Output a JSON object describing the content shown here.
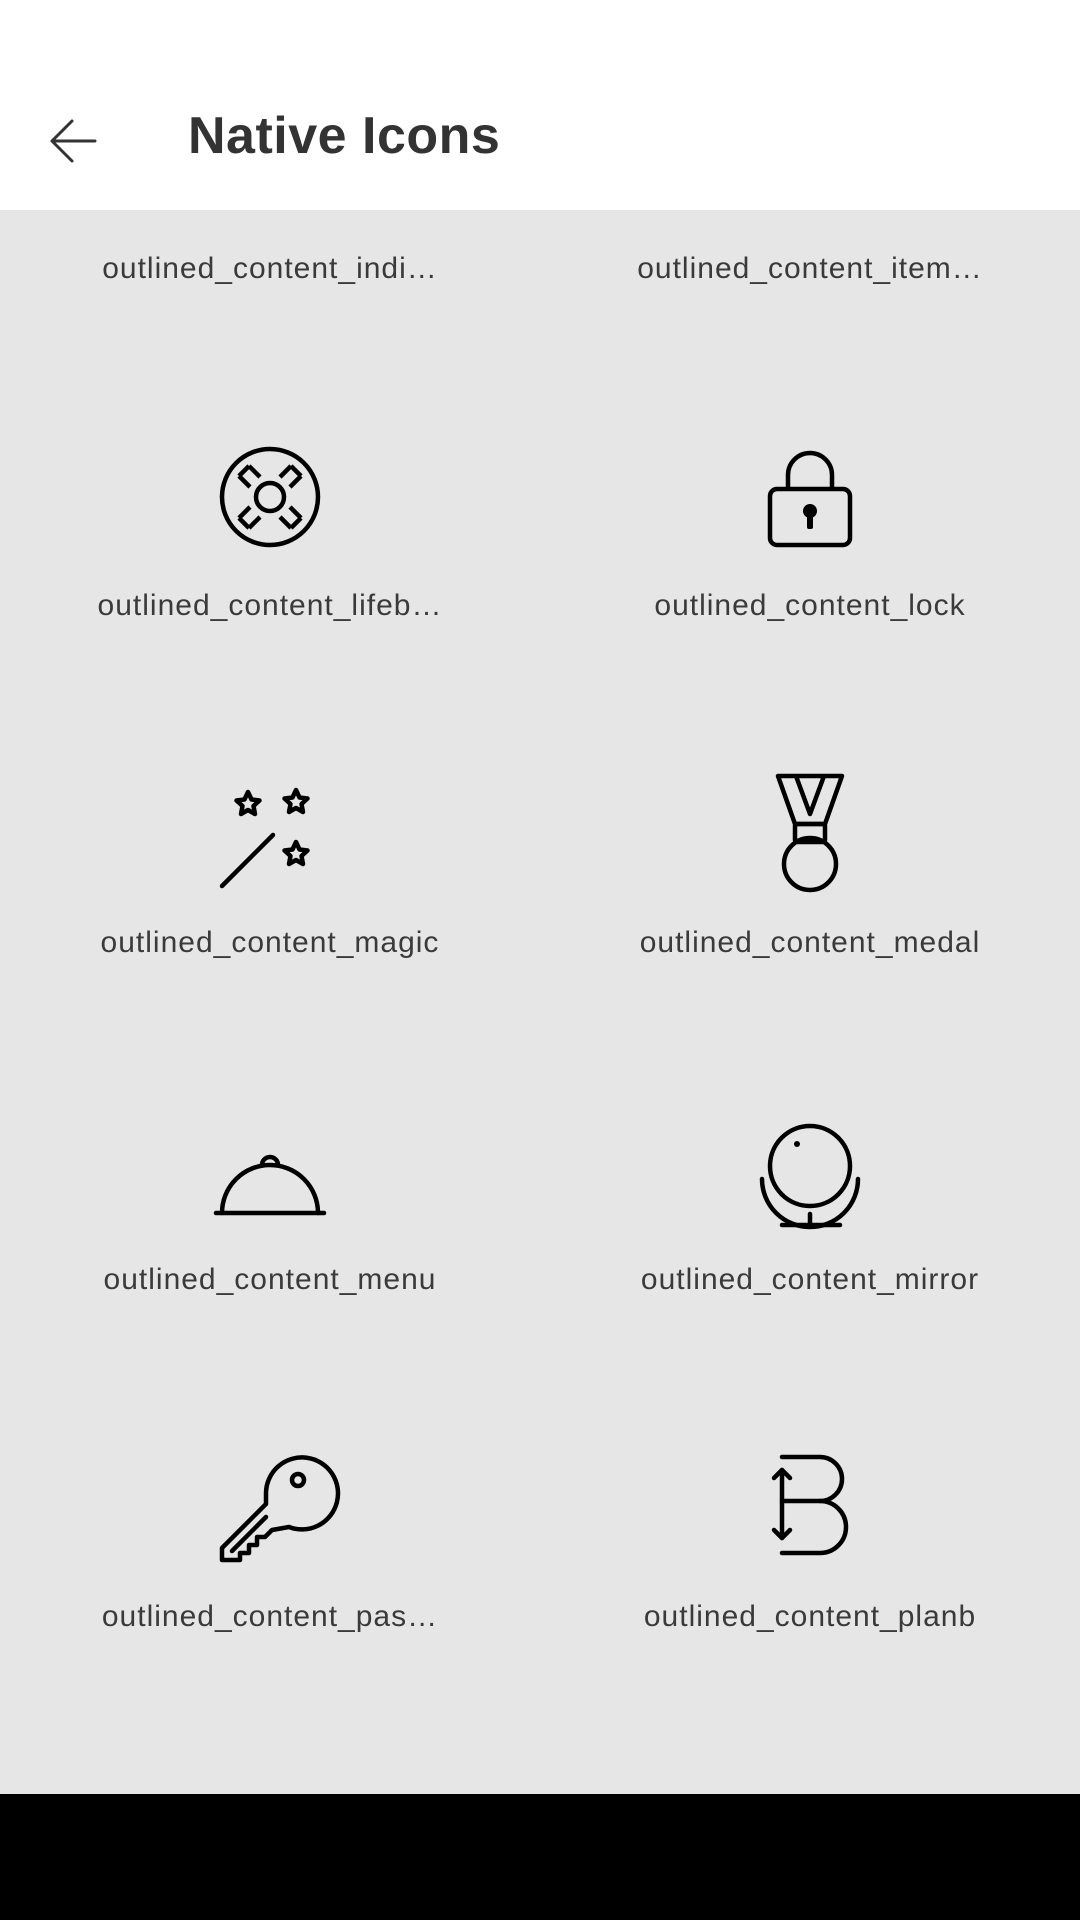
{
  "app_bar": {
    "title": "Native Icons",
    "back_icon": "arrow-left-icon"
  },
  "icon_items": [
    {
      "label": "outlined_content_indi…",
      "icon": "calendar-icon"
    },
    {
      "label": "outlined_content_item…",
      "icon": "search-list-icon"
    },
    {
      "label": "outlined_content_lifeb…",
      "icon": "lifebuoy-icon"
    },
    {
      "label": "outlined_content_lock",
      "icon": "lock-icon"
    },
    {
      "label": "outlined_content_magic",
      "icon": "magic-wand-icon"
    },
    {
      "label": "outlined_content_medal",
      "icon": "medal-icon"
    },
    {
      "label": "outlined_content_menu",
      "icon": "cloche-icon"
    },
    {
      "label": "outlined_content_mirror",
      "icon": "mirror-icon"
    },
    {
      "label": "outlined_content_pas…",
      "icon": "key-icon"
    },
    {
      "label": "outlined_content_planb",
      "icon": "plan-b-icon"
    }
  ],
  "colors": {
    "app_bar_background": "#ffffff",
    "content_background": "#e6e6e6",
    "title_text": "#333333",
    "label_text": "#3a3a3a",
    "icon_stroke": "#000000",
    "navigation_bar": "#000000"
  }
}
